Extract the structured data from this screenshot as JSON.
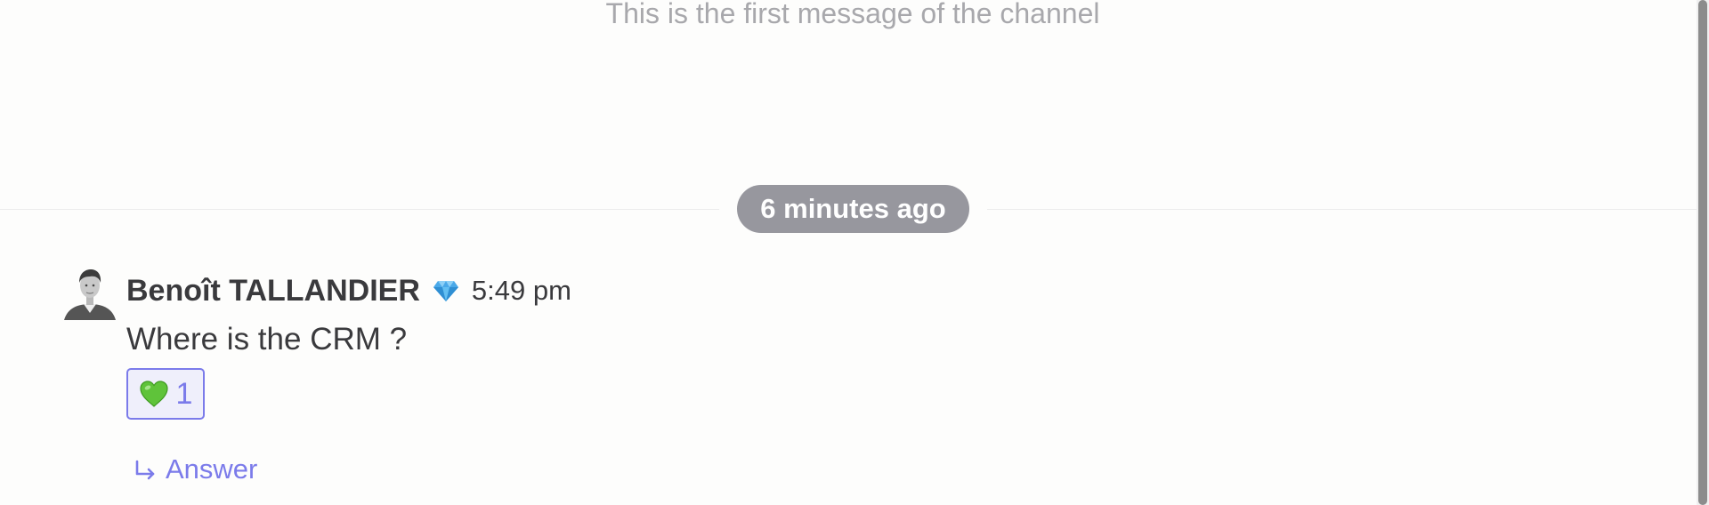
{
  "channel": {
    "start_text": "This is the first message of the channel"
  },
  "divider": {
    "label": "6 minutes ago"
  },
  "message": {
    "author": "Benoît TALLANDIER",
    "badge_icon": "diamond-icon",
    "time": "5:49 pm",
    "text": "Where is the CRM ?",
    "reactions": [
      {
        "emoji": "green-heart-icon",
        "count": "1"
      }
    ],
    "answer_label": "Answer"
  },
  "colors": {
    "accent": "#7b7bea",
    "pill": "#97979e",
    "text": "#3a3a3d",
    "muted": "#a8a8ac",
    "background": "#fdfdfc"
  }
}
